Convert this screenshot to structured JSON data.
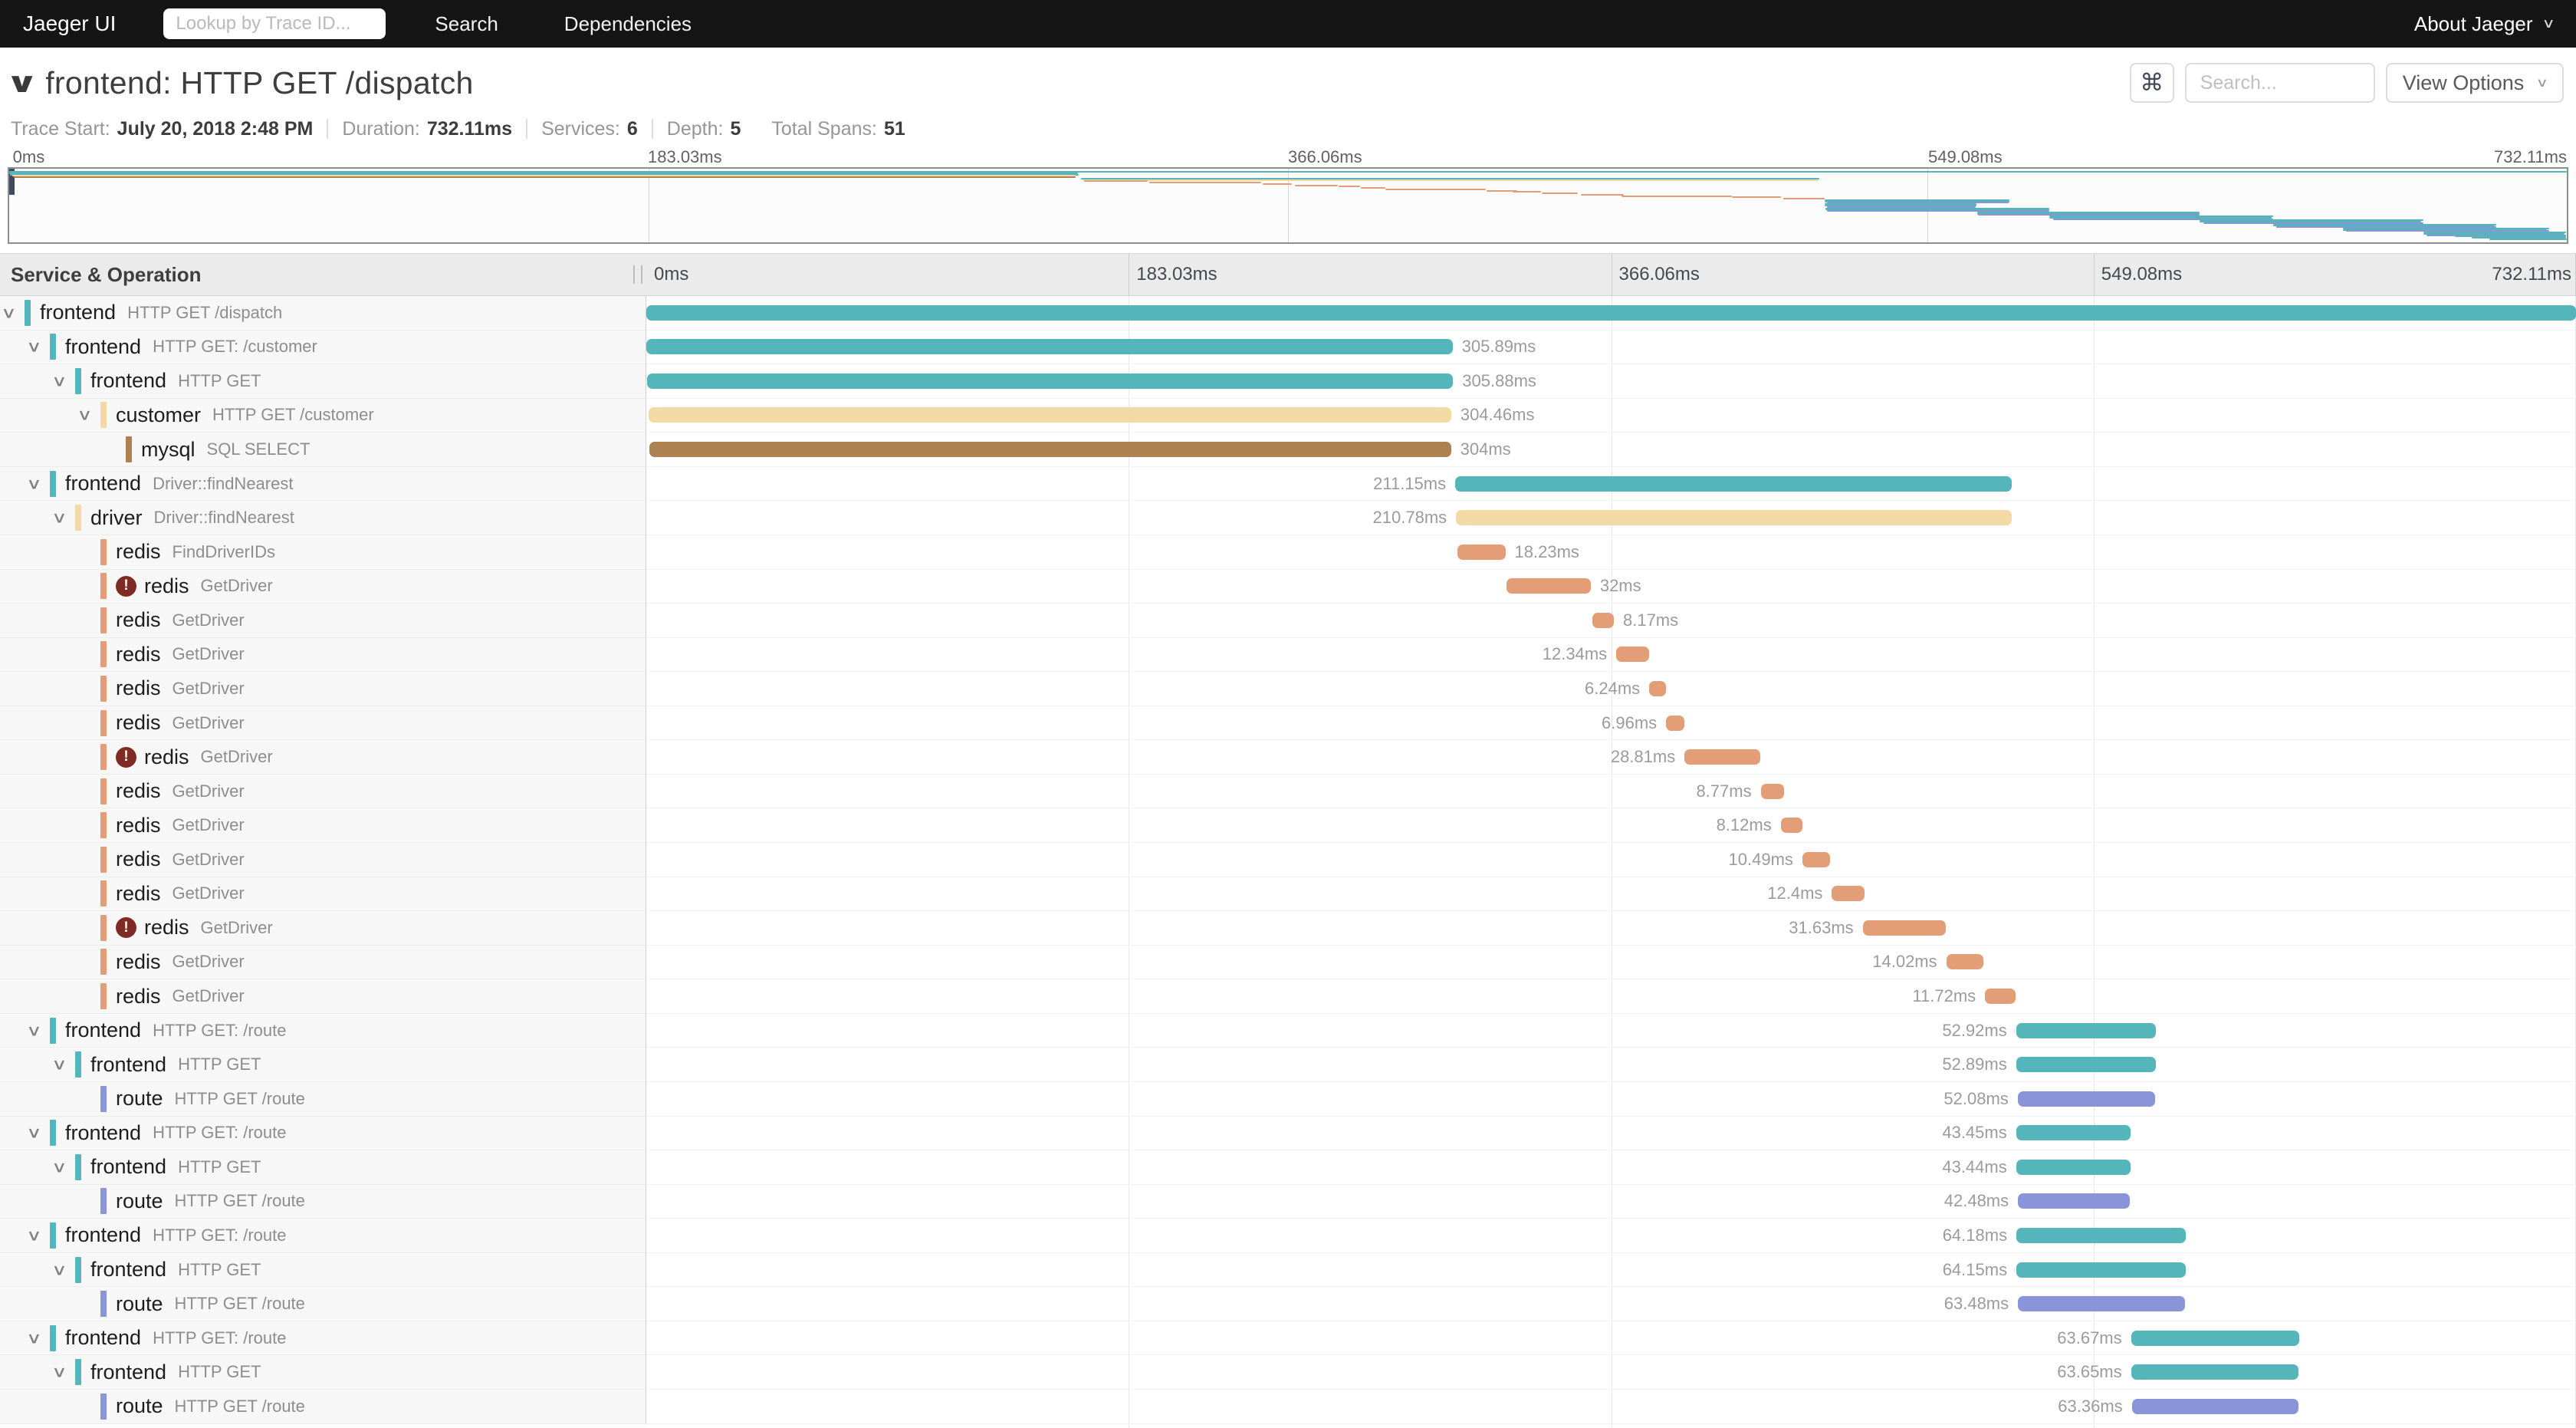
{
  "navbar": {
    "brand": "Jaeger UI",
    "trace_lookup_placeholder": "Lookup by Trace ID...",
    "links": [
      "Search",
      "Dependencies"
    ],
    "about_label": "About Jaeger",
    "caret": "∨"
  },
  "trace_header": {
    "collapse_chevron": "∨",
    "title": "frontend: HTTP GET /dispatch",
    "shortcuts_button": "⌘",
    "search_placeholder": "Search...",
    "view_options_label": "View Options"
  },
  "trace_summary": {
    "items": [
      {
        "label": "Trace Start:",
        "value": "July 20, 2018 2:48 PM",
        "sep_after": true
      },
      {
        "label": "Duration:",
        "value": "732.11ms",
        "sep_after": true
      },
      {
        "label": "Services:",
        "value": "6",
        "sep_after": true
      },
      {
        "label": "Depth:",
        "value": "5",
        "sep_after": false
      },
      {
        "label": "Total Spans:",
        "value": "51",
        "sep_after": false
      }
    ]
  },
  "timeline": {
    "left_header": "Service & Operation",
    "total_ms": 732.11,
    "ticks": [
      {
        "label": "0ms",
        "frac": 0
      },
      {
        "label": "183.03ms",
        "frac": 0.25
      },
      {
        "label": "366.06ms",
        "frac": 0.5
      },
      {
        "label": "549.08ms",
        "frac": 0.75
      },
      {
        "label": "732.11ms",
        "frac": 1
      }
    ]
  },
  "colors": {
    "frontend": "#54b5ba",
    "customer": "#f3d9a4",
    "driver": "#f3d9a4",
    "mysql": "#ad8152",
    "redis": "#e49e77",
    "route": "#8a95d9",
    "error_badge": "#7d2b24"
  },
  "spans": [
    {
      "service": "frontend",
      "operation": "HTTP GET /dispatch",
      "depth": 0,
      "start": 0,
      "duration": 732.11,
      "label": "",
      "label_side": "none",
      "has_children": true,
      "error": false
    },
    {
      "service": "frontend",
      "operation": "HTTP GET: /customer",
      "depth": 1,
      "start": 0,
      "duration": 305.89,
      "label": "305.89ms",
      "label_side": "right",
      "has_children": true,
      "error": false
    },
    {
      "service": "frontend",
      "operation": "HTTP GET",
      "depth": 2,
      "start": 0.2,
      "duration": 305.88,
      "label": "305.88ms",
      "label_side": "right",
      "has_children": true,
      "error": false
    },
    {
      "service": "customer",
      "operation": "HTTP GET /customer",
      "depth": 3,
      "start": 0.9,
      "duration": 304.46,
      "label": "304.46ms",
      "label_side": "right",
      "has_children": true,
      "error": false
    },
    {
      "service": "mysql",
      "operation": "SQL SELECT",
      "depth": 4,
      "start": 1.3,
      "duration": 304,
      "label": "304ms",
      "label_side": "right",
      "has_children": false,
      "error": false
    },
    {
      "service": "frontend",
      "operation": "Driver::findNearest",
      "depth": 1,
      "start": 306.9,
      "duration": 211.15,
      "label": "211.15ms",
      "label_side": "left",
      "has_children": true,
      "error": false
    },
    {
      "service": "driver",
      "operation": "Driver::findNearest",
      "depth": 2,
      "start": 307.2,
      "duration": 210.78,
      "label": "210.78ms",
      "label_side": "left",
      "has_children": true,
      "error": false
    },
    {
      "service": "redis",
      "operation": "FindDriverIDs",
      "depth": 3,
      "start": 307.7,
      "duration": 18.23,
      "label": "18.23ms",
      "label_side": "right",
      "has_children": false,
      "error": false
    },
    {
      "service": "redis",
      "operation": "GetDriver",
      "depth": 3,
      "start": 326.3,
      "duration": 32,
      "label": "32ms",
      "label_side": "right",
      "has_children": false,
      "error": true
    },
    {
      "service": "redis",
      "operation": "GetDriver",
      "depth": 3,
      "start": 358.9,
      "duration": 8.17,
      "label": "8.17ms",
      "label_side": "right",
      "has_children": false,
      "error": false
    },
    {
      "service": "redis",
      "operation": "GetDriver",
      "depth": 3,
      "start": 368,
      "duration": 12.34,
      "label": "12.34ms",
      "label_side": "left",
      "has_children": false,
      "error": false
    },
    {
      "service": "redis",
      "operation": "GetDriver",
      "depth": 3,
      "start": 380.5,
      "duration": 6.24,
      "label": "6.24ms",
      "label_side": "left",
      "has_children": false,
      "error": false
    },
    {
      "service": "redis",
      "operation": "GetDriver",
      "depth": 3,
      "start": 386.9,
      "duration": 6.96,
      "label": "6.96ms",
      "label_side": "left",
      "has_children": false,
      "error": false
    },
    {
      "service": "redis",
      "operation": "GetDriver",
      "depth": 3,
      "start": 393.9,
      "duration": 28.81,
      "label": "28.81ms",
      "label_side": "left",
      "has_children": false,
      "error": true
    },
    {
      "service": "redis",
      "operation": "GetDriver",
      "depth": 3,
      "start": 422.8,
      "duration": 8.77,
      "label": "8.77ms",
      "label_side": "left",
      "has_children": false,
      "error": false
    },
    {
      "service": "redis",
      "operation": "GetDriver",
      "depth": 3,
      "start": 430.4,
      "duration": 8.12,
      "label": "8.12ms",
      "label_side": "left",
      "has_children": false,
      "error": false
    },
    {
      "service": "redis",
      "operation": "GetDriver",
      "depth": 3,
      "start": 438.6,
      "duration": 10.49,
      "label": "10.49ms",
      "label_side": "left",
      "has_children": false,
      "error": false
    },
    {
      "service": "redis",
      "operation": "GetDriver",
      "depth": 3,
      "start": 449.8,
      "duration": 12.4,
      "label": "12.4ms",
      "label_side": "left",
      "has_children": false,
      "error": false
    },
    {
      "service": "redis",
      "operation": "GetDriver",
      "depth": 3,
      "start": 461.5,
      "duration": 31.63,
      "label": "31.63ms",
      "label_side": "left",
      "has_children": false,
      "error": true
    },
    {
      "service": "redis",
      "operation": "GetDriver",
      "depth": 3,
      "start": 493.2,
      "duration": 14.02,
      "label": "14.02ms",
      "label_side": "left",
      "has_children": false,
      "error": false
    },
    {
      "service": "redis",
      "operation": "GetDriver",
      "depth": 3,
      "start": 507.9,
      "duration": 11.72,
      "label": "11.72ms",
      "label_side": "left",
      "has_children": false,
      "error": false
    },
    {
      "service": "frontend",
      "operation": "HTTP GET: /route",
      "depth": 1,
      "start": 519.7,
      "duration": 52.92,
      "label": "52.92ms",
      "label_side": "left",
      "has_children": true,
      "error": false
    },
    {
      "service": "frontend",
      "operation": "HTTP GET",
      "depth": 2,
      "start": 519.7,
      "duration": 52.89,
      "label": "52.89ms",
      "label_side": "left",
      "has_children": true,
      "error": false
    },
    {
      "service": "route",
      "operation": "HTTP GET /route",
      "depth": 3,
      "start": 520.3,
      "duration": 52.08,
      "label": "52.08ms",
      "label_side": "left",
      "has_children": false,
      "error": false
    },
    {
      "service": "frontend",
      "operation": "HTTP GET: /route",
      "depth": 1,
      "start": 519.7,
      "duration": 43.45,
      "label": "43.45ms",
      "label_side": "left",
      "has_children": true,
      "error": false
    },
    {
      "service": "frontend",
      "operation": "HTTP GET",
      "depth": 2,
      "start": 519.7,
      "duration": 43.44,
      "label": "43.44ms",
      "label_side": "left",
      "has_children": true,
      "error": false
    },
    {
      "service": "route",
      "operation": "HTTP GET /route",
      "depth": 3,
      "start": 520.4,
      "duration": 42.48,
      "label": "42.48ms",
      "label_side": "left",
      "has_children": false,
      "error": false
    },
    {
      "service": "frontend",
      "operation": "HTTP GET: /route",
      "depth": 1,
      "start": 519.8,
      "duration": 64.18,
      "label": "64.18ms",
      "label_side": "left",
      "has_children": true,
      "error": false
    },
    {
      "service": "frontend",
      "operation": "HTTP GET",
      "depth": 2,
      "start": 519.8,
      "duration": 64.15,
      "label": "64.15ms",
      "label_side": "left",
      "has_children": true,
      "error": false
    },
    {
      "service": "route",
      "operation": "HTTP GET /route",
      "depth": 3,
      "start": 520.4,
      "duration": 63.48,
      "label": "63.48ms",
      "label_side": "left",
      "has_children": false,
      "error": false
    },
    {
      "service": "frontend",
      "operation": "HTTP GET: /route",
      "depth": 1,
      "start": 563.3,
      "duration": 63.67,
      "label": "63.67ms",
      "label_side": "left",
      "has_children": true,
      "error": false
    },
    {
      "service": "frontend",
      "operation": "HTTP GET",
      "depth": 2,
      "start": 563.3,
      "duration": 63.65,
      "label": "63.65ms",
      "label_side": "left",
      "has_children": true,
      "error": false
    },
    {
      "service": "route",
      "operation": "HTTP GET /route",
      "depth": 3,
      "start": 563.6,
      "duration": 63.36,
      "label": "63.36ms",
      "label_side": "left",
      "has_children": false,
      "error": false
    }
  ],
  "minimap_tail_spans": [
    {
      "start": 584,
      "duration": 64,
      "service": "frontend"
    },
    {
      "start": 584,
      "duration": 63.6,
      "service": "frontend"
    },
    {
      "start": 585,
      "duration": 63,
      "service": "route"
    },
    {
      "start": 627,
      "duration": 64,
      "service": "frontend"
    },
    {
      "start": 627,
      "duration": 63.5,
      "service": "frontend"
    },
    {
      "start": 628,
      "duration": 63,
      "service": "route"
    },
    {
      "start": 648,
      "duration": 64,
      "service": "frontend"
    },
    {
      "start": 648,
      "duration": 63.5,
      "service": "frontend"
    },
    {
      "start": 649,
      "duration": 63,
      "service": "route"
    },
    {
      "start": 668,
      "duration": 59,
      "service": "frontend"
    },
    {
      "start": 668,
      "duration": 58.5,
      "service": "frontend"
    },
    {
      "start": 669,
      "duration": 58,
      "service": "route"
    },
    {
      "start": 691,
      "duration": 41,
      "service": "frontend"
    },
    {
      "start": 691,
      "duration": 40.5,
      "service": "frontend"
    },
    {
      "start": 692,
      "duration": 40,
      "service": "route"
    },
    {
      "start": 700,
      "duration": 32,
      "service": "frontend"
    },
    {
      "start": 705,
      "duration": 27,
      "service": "frontend"
    },
    {
      "start": 710,
      "duration": 22.11,
      "service": "frontend"
    }
  ]
}
